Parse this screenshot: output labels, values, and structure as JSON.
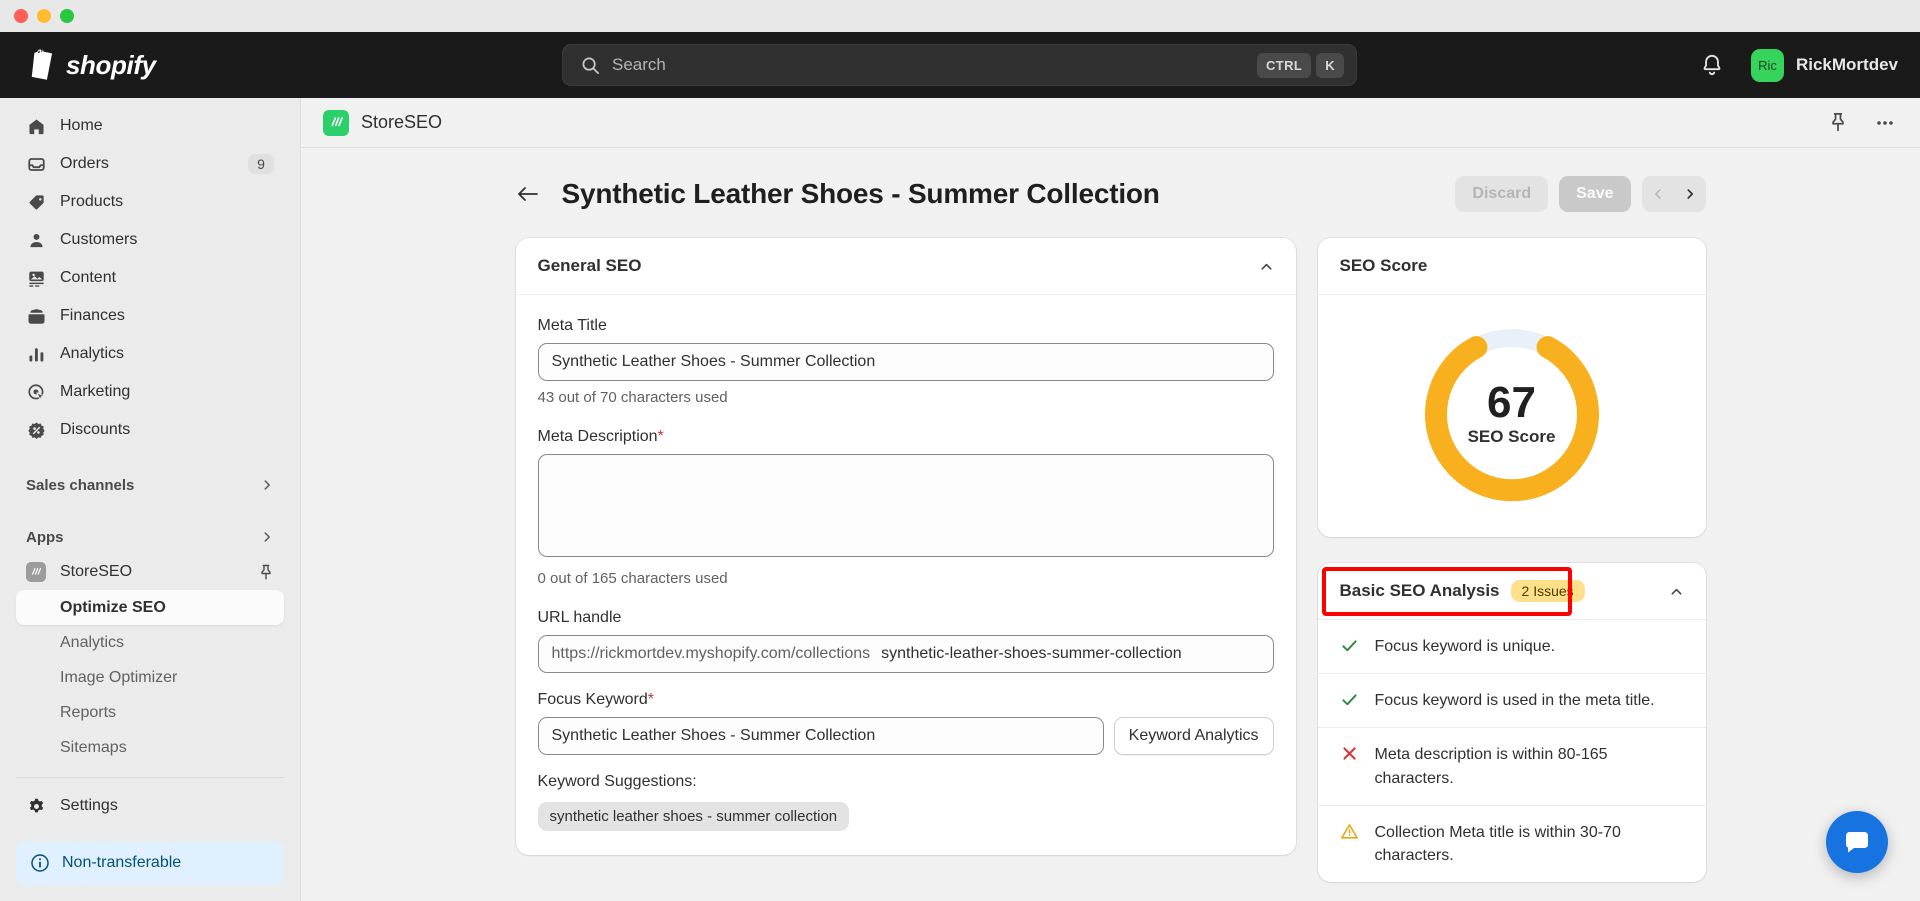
{
  "window": {
    "traffic_lights": [
      "close",
      "minimize",
      "maximize"
    ]
  },
  "topbar": {
    "brand": "shopify",
    "search": {
      "placeholder": "Search",
      "kbd_ctrl": "CTRL",
      "kbd_key": "K",
      "icon": "search-icon"
    },
    "notifications_icon": "bell-icon",
    "user": {
      "initials": "Ric",
      "name": "RickMortdev"
    }
  },
  "sidebar": {
    "items": [
      {
        "label": "Home",
        "icon": "home-icon",
        "badge": ""
      },
      {
        "label": "Orders",
        "icon": "orders-inbox-icon",
        "badge": "9"
      },
      {
        "label": "Products",
        "icon": "tag-icon",
        "badge": ""
      },
      {
        "label": "Customers",
        "icon": "person-icon",
        "badge": ""
      },
      {
        "label": "Content",
        "icon": "content-image-icon",
        "badge": ""
      },
      {
        "label": "Finances",
        "icon": "wallet-icon",
        "badge": ""
      },
      {
        "label": "Analytics",
        "icon": "bar-chart-icon",
        "badge": ""
      },
      {
        "label": "Marketing",
        "icon": "target-cursor-icon",
        "badge": ""
      },
      {
        "label": "Discounts",
        "icon": "discount-percent-icon",
        "badge": ""
      }
    ],
    "sales_channels": {
      "label": "Sales channels",
      "icon": "chevron-right-icon"
    },
    "apps": {
      "label": "Apps",
      "icon": "chevron-right-icon"
    },
    "app": {
      "label": "StoreSEO",
      "icon": "storeseo-app-icon",
      "pin_icon": "pin-icon"
    },
    "sub_items": [
      {
        "label": "Optimize SEO",
        "active": true
      },
      {
        "label": "Analytics",
        "active": false
      },
      {
        "label": "Image Optimizer",
        "active": false
      },
      {
        "label": "Reports",
        "active": false
      },
      {
        "label": "Sitemaps",
        "active": false
      }
    ],
    "settings": {
      "label": "Settings",
      "icon": "gear-icon"
    },
    "non_transferable": {
      "label": "Non-transferable",
      "icon": "info-circle-icon"
    }
  },
  "app_bar": {
    "title": "StoreSEO",
    "logo_icon": "storeseo-logo-icon",
    "pin_icon": "pin-icon",
    "more_icon": "ellipsis-icon"
  },
  "page": {
    "back_icon": "arrow-left-icon",
    "title": "Synthetic Leather Shoes - Summer Collection",
    "discard_label": "Discard",
    "save_label": "Save",
    "prev_icon": "chevron-left-icon",
    "next_icon": "chevron-right-icon"
  },
  "general_seo": {
    "title": "General SEO",
    "collapse_icon": "chevron-up-icon",
    "meta_title": {
      "label": "Meta Title",
      "value": "Synthetic Leather Shoes - Summer Collection",
      "placeholder": "",
      "help": "43 out of 70 characters used"
    },
    "meta_description": {
      "label": "Meta Description",
      "required": "*",
      "value": "",
      "placeholder": "",
      "help": "0 out of 165 characters used"
    },
    "url_handle": {
      "label": "URL handle",
      "prefix": "https://rickmortdev.myshopify.com/collections",
      "value": "synthetic-leather-shoes-summer-collection"
    },
    "focus_keyword": {
      "label": "Focus Keyword",
      "required": "*",
      "value": "Synthetic Leather Shoes - Summer Collection",
      "placeholder": "",
      "button_label": "Keyword Analytics"
    },
    "suggestions": {
      "label": "Keyword Suggestions:",
      "chips": [
        "synthetic leather shoes - summer collection"
      ]
    }
  },
  "seo_score": {
    "title": "SEO Score",
    "value": "67",
    "caption": "SEO Score",
    "accent_color": "#F9B01E",
    "track_color": "#EAF0F7"
  },
  "analysis": {
    "title": "Basic SEO Analysis",
    "badge": "2 Issues",
    "badge_color": "#FFE08A",
    "collapse_icon": "chevron-up-icon",
    "items": [
      {
        "status": "pass",
        "icon": "check-icon",
        "text": "Focus keyword is unique."
      },
      {
        "status": "pass",
        "icon": "check-icon",
        "text": "Focus keyword is used in the meta title."
      },
      {
        "status": "fail",
        "icon": "cross-icon",
        "text": "Meta description is within 80-165 characters."
      },
      {
        "status": "warn",
        "icon": "warning-triangle-icon",
        "text": "Collection Meta title is within 30-70 characters."
      }
    ],
    "status_colors": {
      "pass": "#2E8540",
      "fail": "#E03131",
      "warn": "#E6A817"
    },
    "highlight_color": "#FF0000"
  },
  "chat": {
    "icon": "chat-bubble-icon",
    "color": "#1773E0"
  }
}
